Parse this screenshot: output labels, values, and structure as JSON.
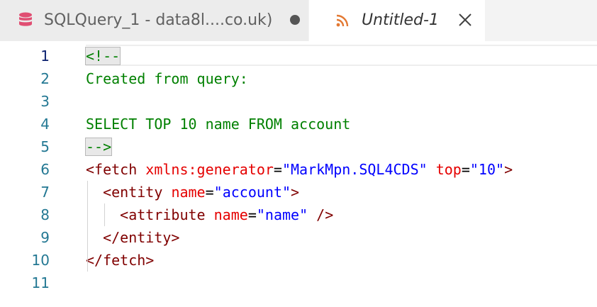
{
  "tabs": [
    {
      "label": "SQLQuery_1 - data8l....co.uk)",
      "icon": "database-icon",
      "state": "modified",
      "active": false
    },
    {
      "label": "Untitled-1",
      "icon": "rss-icon",
      "active": true
    }
  ],
  "colors": {
    "database_icon": "#e04e72",
    "rss_icon": "#e37933",
    "line_number": "#237893",
    "line_number_current": "#0b216f",
    "comment": "#008000",
    "tag": "#800000",
    "attribute": "#e50000",
    "string": "#0000ff"
  },
  "editor": {
    "line_numbers": [
      "1",
      "2",
      "3",
      "4",
      "5",
      "6",
      "7",
      "8",
      "9",
      "10",
      "11"
    ],
    "current_line": 1,
    "lines": {
      "l1": {
        "comment": "<!--"
      },
      "l2": {
        "comment": "Created from query:"
      },
      "l3": {},
      "l4": {
        "comment": "SELECT TOP 10 name FROM account"
      },
      "l5": {
        "comment": "-->"
      },
      "l6": {
        "open": "<fetch",
        "attr1": "xmlns:generator",
        "eq1": "=",
        "val1": "\"MarkMpn.SQL4CDS\"",
        "attr2": "top",
        "eq2": "=",
        "val2": "\"10\"",
        "close": ">"
      },
      "l7": {
        "open": "<entity",
        "attr1": "name",
        "eq1": "=",
        "val1": "\"account\"",
        "close": ">"
      },
      "l8": {
        "open": "<attribute",
        "attr1": "name",
        "eq1": "=",
        "val1": "\"name\"",
        "close": "/>"
      },
      "l9": {
        "tag": "</entity>"
      },
      "l10": {
        "tag": "</fetch>"
      },
      "l11": {}
    }
  }
}
